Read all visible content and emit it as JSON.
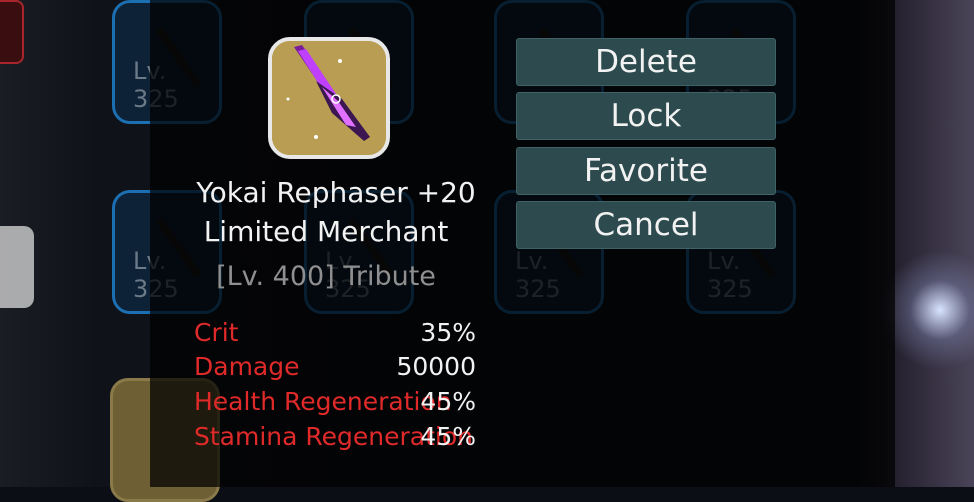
{
  "background": {
    "slot_level_label": "Lv. 325"
  },
  "item": {
    "name": "Yokai Rephaser +20",
    "source": "Limited Merchant",
    "level_line": "[Lv. 400] Tribute",
    "icon": "purple-blade-icon"
  },
  "stats": [
    {
      "label": "Crit",
      "value": "35%"
    },
    {
      "label": "Damage",
      "value": "50000"
    },
    {
      "label": "Health Regeneration",
      "value": "45%"
    },
    {
      "label": "Stamina Regeneration",
      "value": "45%"
    }
  ],
  "actions": {
    "delete": "Delete",
    "lock": "Lock",
    "favorite": "Favorite",
    "cancel": "Cancel"
  },
  "colors": {
    "stat_label": "#e02a2a",
    "button_bg": "#2d4b4e",
    "slot_border": "#1c6fb0"
  }
}
